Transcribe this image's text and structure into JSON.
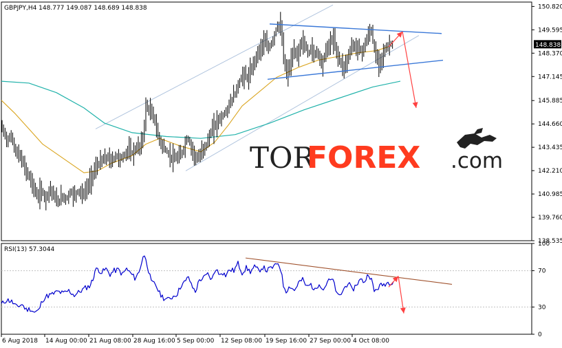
{
  "chart_data": [
    {
      "type": "candlestick",
      "header": "GBPJPY,H4  148.777 149.087 148.689 148.838",
      "symbol": "GBPJPY",
      "timeframe": "H4",
      "ohlc_last": {
        "open": 148.777,
        "high": 149.087,
        "low": 148.689,
        "close": 148.838
      },
      "current_price_label": "148.838",
      "ylim": [
        138.535,
        151.05
      ],
      "y_ticks": [
        "150.820",
        "149.595",
        "148.370",
        "147.145",
        "145.885",
        "144.660",
        "143.435",
        "142.210",
        "140.985",
        "139.760",
        "138.535"
      ],
      "x_ticks": [
        "6 Aug 2018",
        "14 Aug 00:00",
        "21 Aug 08:00",
        "28 Aug 16:00",
        "5 Sep 00:00",
        "12 Sep 08:00",
        "19 Sep 16:00",
        "27 Sep 00:00",
        "4 Oct 08:00"
      ],
      "price_path": [
        [
          0,
          144.5
        ],
        [
          8,
          143.8
        ],
        [
          15,
          144.0
        ],
        [
          20,
          143.2
        ],
        [
          28,
          142.9
        ],
        [
          34,
          142.3
        ],
        [
          40,
          141.9
        ],
        [
          46,
          141.4
        ],
        [
          52,
          140.8
        ],
        [
          58,
          141.2
        ],
        [
          64,
          140.7
        ],
        [
          70,
          141.3
        ],
        [
          76,
          140.9
        ],
        [
          82,
          140.5
        ],
        [
          88,
          140.9
        ],
        [
          94,
          140.7
        ],
        [
          100,
          141.1
        ],
        [
          106,
          140.9
        ],
        [
          112,
          141.2
        ],
        [
          118,
          140.9
        ],
        [
          124,
          141.3
        ],
        [
          130,
          141.8
        ],
        [
          136,
          142.3
        ],
        [
          142,
          142.6
        ],
        [
          148,
          142.8
        ],
        [
          154,
          142.9
        ],
        [
          160,
          142.7
        ],
        [
          166,
          143.0
        ],
        [
          172,
          142.8
        ],
        [
          178,
          143.0
        ],
        [
          184,
          143.3
        ],
        [
          190,
          143.1
        ],
        [
          196,
          143.4
        ],
        [
          202,
          143.5
        ],
        [
          206,
          144.0
        ],
        [
          210,
          145.6
        ],
        [
          216,
          145.3
        ],
        [
          222,
          145.0
        ],
        [
          226,
          144.2
        ],
        [
          232,
          143.6
        ],
        [
          238,
          143.3
        ],
        [
          244,
          143.0
        ],
        [
          250,
          142.8
        ],
        [
          256,
          142.9
        ],
        [
          262,
          143.1
        ],
        [
          266,
          143.5
        ],
        [
          270,
          144.0
        ],
        [
          274,
          143.6
        ],
        [
          280,
          143.0
        ],
        [
          286,
          142.8
        ],
        [
          292,
          143.3
        ],
        [
          298,
          143.6
        ],
        [
          304,
          144.2
        ],
        [
          310,
          144.6
        ],
        [
          316,
          144.9
        ],
        [
          322,
          145.1
        ],
        [
          328,
          145.4
        ],
        [
          334,
          145.9
        ],
        [
          340,
          146.3
        ],
        [
          346,
          146.9
        ],
        [
          352,
          147.3
        ],
        [
          358,
          147.0
        ],
        [
          364,
          147.6
        ],
        [
          370,
          148.2
        ],
        [
          376,
          148.6
        ],
        [
          382,
          149.0
        ],
        [
          388,
          148.6
        ],
        [
          394,
          149.0
        ],
        [
          398,
          149.5
        ],
        [
          402,
          149.9
        ],
        [
          406,
          149.7
        ],
        [
          410,
          148.2
        ],
        [
          414,
          147.2
        ],
        [
          418,
          147.6
        ],
        [
          422,
          148.1
        ],
        [
          426,
          148.5
        ],
        [
          430,
          148.2
        ],
        [
          434,
          148.8
        ],
        [
          438,
          149.0
        ],
        [
          442,
          148.7
        ],
        [
          446,
          148.3
        ],
        [
          450,
          148.7
        ],
        [
          454,
          148.2
        ],
        [
          458,
          148.6
        ],
        [
          462,
          148.1
        ],
        [
          466,
          147.8
        ],
        [
          470,
          148.3
        ],
        [
          474,
          148.7
        ],
        [
          478,
          148.9
        ],
        [
          482,
          149.2
        ],
        [
          486,
          148.6
        ],
        [
          490,
          148.1
        ],
        [
          494,
          147.8
        ],
        [
          498,
          147.6
        ],
        [
          502,
          148.0
        ],
        [
          506,
          148.4
        ],
        [
          510,
          148.9
        ],
        [
          514,
          148.6
        ],
        [
          518,
          148.8
        ],
        [
          522,
          148.4
        ],
        [
          526,
          148.6
        ],
        [
          530,
          149.0
        ],
        [
          534,
          149.4
        ],
        [
          538,
          149.6
        ],
        [
          541,
          148.7
        ],
        [
          544,
          148.2
        ],
        [
          548,
          147.9
        ],
        [
          552,
          148.1
        ],
        [
          556,
          148.4
        ],
        [
          560,
          148.7
        ],
        [
          566,
          148.9
        ],
        [
          570,
          148.8
        ]
      ],
      "ma_slow": [
        [
          0,
          146.9
        ],
        [
          40,
          146.8
        ],
        [
          80,
          146.3
        ],
        [
          120,
          145.5
        ],
        [
          150,
          144.7
        ],
        [
          190,
          144.2
        ],
        [
          240,
          144.0
        ],
        [
          290,
          143.9
        ],
        [
          340,
          144.1
        ],
        [
          390,
          144.7
        ],
        [
          440,
          145.4
        ],
        [
          490,
          146.0
        ],
        [
          540,
          146.6
        ],
        [
          580,
          146.9
        ]
      ],
      "ma_fast": [
        [
          0,
          145.9
        ],
        [
          20,
          145.2
        ],
        [
          40,
          144.4
        ],
        [
          60,
          143.6
        ],
        [
          80,
          143.1
        ],
        [
          100,
          142.6
        ],
        [
          120,
          142.1
        ],
        [
          140,
          142.2
        ],
        [
          160,
          142.6
        ],
        [
          190,
          143.0
        ],
        [
          210,
          143.6
        ],
        [
          230,
          143.9
        ],
        [
          260,
          143.5
        ],
        [
          290,
          143.2
        ],
        [
          310,
          143.7
        ],
        [
          330,
          144.6
        ],
        [
          350,
          145.6
        ],
        [
          380,
          146.5
        ],
        [
          400,
          147.1
        ],
        [
          430,
          147.6
        ],
        [
          460,
          148.0
        ],
        [
          490,
          148.2
        ],
        [
          520,
          148.4
        ],
        [
          545,
          148.5
        ],
        [
          562,
          148.7
        ]
      ],
      "channel": {
        "upper": [
          [
            137,
            144.4
          ],
          [
            482,
            150.9
          ]
        ],
        "lower": [
          [
            268,
            142.2
          ],
          [
            607,
            149.3
          ]
        ]
      },
      "triangle": {
        "upper": [
          [
            390,
            149.9
          ],
          [
            640,
            149.4
          ]
        ],
        "lower": [
          [
            387,
            147.0
          ],
          [
            642,
            148.0
          ]
        ]
      },
      "projection": {
        "start": [
          563,
          148.7
        ],
        "peak": [
          583,
          149.5
        ],
        "end": [
          603,
          145.5
        ]
      },
      "colors": {
        "price": "#000000",
        "ma_slow": "#20b2aa",
        "ma_fast": "#daa520",
        "channel": "#b0c4de",
        "triangle": "#3a78d8",
        "arrow": "#ff4040"
      }
    },
    {
      "type": "line",
      "header": "RSI(13) 57.3044",
      "indicator": "RSI(13)",
      "last_value": 57.3044,
      "ylim": [
        0,
        100
      ],
      "y_ticks": [
        "100",
        "70",
        "30",
        "0"
      ],
      "levels": [
        70,
        30
      ],
      "x_ticks": [
        "6 Aug 2018",
        "14 Aug 00:00",
        "21 Aug 08:00",
        "28 Aug 16:00",
        "5 Sep 00:00",
        "12 Sep 08:00",
        "19 Sep 16:00",
        "27 Sep 00:00",
        "4 Oct 08:00"
      ],
      "series_points": [
        [
          0,
          33
        ],
        [
          8,
          38
        ],
        [
          15,
          36
        ],
        [
          22,
          30
        ],
        [
          30,
          33
        ],
        [
          36,
          27
        ],
        [
          42,
          28
        ],
        [
          48,
          24
        ],
        [
          54,
          26
        ],
        [
          60,
          38
        ],
        [
          66,
          42
        ],
        [
          74,
          44
        ],
        [
          82,
          47
        ],
        [
          90,
          45
        ],
        [
          98,
          48
        ],
        [
          106,
          43
        ],
        [
          114,
          47
        ],
        [
          122,
          51
        ],
        [
          128,
          53
        ],
        [
          133,
          60
        ],
        [
          136,
          70
        ],
        [
          140,
          72
        ],
        [
          146,
          68
        ],
        [
          152,
          72
        ],
        [
          158,
          66
        ],
        [
          164,
          70
        ],
        [
          170,
          71
        ],
        [
          176,
          66
        ],
        [
          182,
          72
        ],
        [
          188,
          67
        ],
        [
          194,
          62
        ],
        [
          200,
          68
        ],
        [
          206,
          86
        ],
        [
          210,
          84
        ],
        [
          214,
          70
        ],
        [
          218,
          57
        ],
        [
          224,
          55
        ],
        [
          230,
          45
        ],
        [
          236,
          40
        ],
        [
          242,
          38
        ],
        [
          248,
          41
        ],
        [
          256,
          45
        ],
        [
          262,
          55
        ],
        [
          268,
          58
        ],
        [
          272,
          64
        ],
        [
          276,
          54
        ],
        [
          282,
          47
        ],
        [
          288,
          60
        ],
        [
          294,
          62
        ],
        [
          300,
          66
        ],
        [
          306,
          60
        ],
        [
          312,
          73
        ],
        [
          316,
          66
        ],
        [
          320,
          69
        ],
        [
          326,
          65
        ],
        [
          332,
          71
        ],
        [
          338,
          70
        ],
        [
          344,
          78
        ],
        [
          350,
          68
        ],
        [
          356,
          73
        ],
        [
          362,
          69
        ],
        [
          368,
          74
        ],
        [
          374,
          70
        ],
        [
          380,
          74
        ],
        [
          386,
          70
        ],
        [
          392,
          73
        ],
        [
          398,
          75
        ],
        [
          402,
          79
        ],
        [
          406,
          72
        ],
        [
          410,
          54
        ],
        [
          414,
          48
        ],
        [
          420,
          53
        ],
        [
          426,
          48
        ],
        [
          432,
          57
        ],
        [
          438,
          60
        ],
        [
          444,
          52
        ],
        [
          450,
          55
        ],
        [
          456,
          48
        ],
        [
          462,
          57
        ],
        [
          468,
          49
        ],
        [
          474,
          58
        ],
        [
          480,
          60
        ],
        [
          484,
          56
        ],
        [
          488,
          43
        ],
        [
          492,
          42
        ],
        [
          498,
          50
        ],
        [
          504,
          57
        ],
        [
          510,
          48
        ],
        [
          516,
          55
        ],
        [
          522,
          60
        ],
        [
          528,
          58
        ],
        [
          534,
          67
        ],
        [
          538,
          60
        ],
        [
          542,
          47
        ],
        [
          546,
          50
        ],
        [
          550,
          53
        ],
        [
          556,
          55
        ],
        [
          562,
          57
        ],
        [
          570,
          58
        ]
      ],
      "trendline": [
        [
          355,
          84
        ],
        [
          655,
          55
        ]
      ],
      "projection": {
        "start": [
          563,
          52
        ],
        "peak": [
          577,
          64
        ],
        "end": [
          585,
          23
        ]
      },
      "colors": {
        "series": "#0000cd",
        "trendline": "#a0522d",
        "arrow": "#ff4040"
      }
    }
  ],
  "logo": {
    "part1": "TOR",
    "part2": "FOREX",
    "part3": ".com"
  }
}
